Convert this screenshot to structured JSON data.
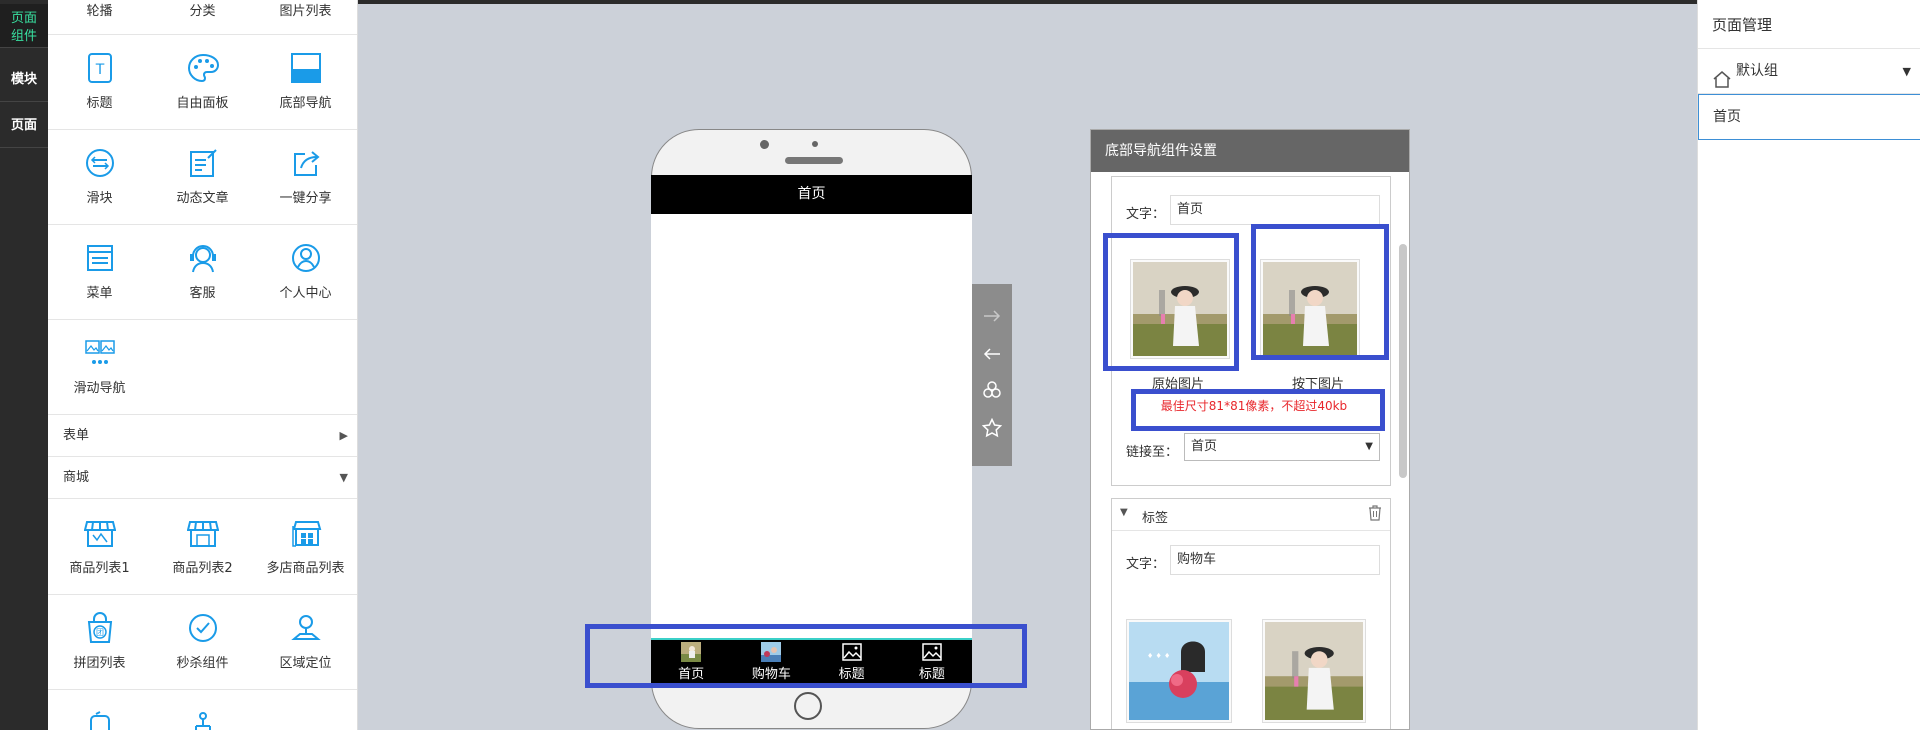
{
  "rail": {
    "items": [
      "页面组件",
      "模块",
      "页面"
    ]
  },
  "panel": {
    "top_row": [
      "轮播",
      "分类",
      "图片列表"
    ],
    "rows": [
      [
        {
          "label": "标题",
          "icon": "title-icon"
        },
        {
          "label": "自由面板",
          "icon": "palette-icon"
        },
        {
          "label": "底部导航",
          "icon": "bottom-nav-icon"
        }
      ],
      [
        {
          "label": "滑块",
          "icon": "slider-icon"
        },
        {
          "label": "动态文章",
          "icon": "article-icon"
        },
        {
          "label": "一键分享",
          "icon": "share-icon"
        }
      ],
      [
        {
          "label": "菜单",
          "icon": "menu-icon"
        },
        {
          "label": "客服",
          "icon": "customer-service-icon"
        },
        {
          "label": "个人中心",
          "icon": "user-center-icon"
        }
      ],
      [
        {
          "label": "滑动导航",
          "icon": "swipe-nav-icon"
        }
      ]
    ],
    "section_form": "表单",
    "section_form_arrow": "▶",
    "section_mall": "商城",
    "section_mall_arrow": "▼",
    "mall_rows": [
      [
        {
          "label": "商品列表1",
          "icon": "store-icon"
        },
        {
          "label": "商品列表2",
          "icon": "store-icon"
        },
        {
          "label": "多店商品列表",
          "icon": "multi-store-icon"
        }
      ],
      [
        {
          "label": "拼团列表",
          "icon": "group-buy-icon"
        },
        {
          "label": "秒杀组件",
          "icon": "flash-sale-icon"
        },
        {
          "label": "区域定位",
          "icon": "location-icon"
        }
      ]
    ]
  },
  "phone": {
    "header_title": "首页",
    "tabs": [
      "首页",
      "购物车",
      "标题",
      "标题"
    ]
  },
  "settings": {
    "title": "底部导航组件设置",
    "item1": {
      "text_label": "文字：",
      "text_value": "首页",
      "original_caption": "原始图片",
      "pressed_caption": "按下图片",
      "hint": "最佳尺寸81*81像素，不超过40kb",
      "link_label": "链接至：",
      "link_value": "首页",
      "link_arrow": "▼"
    },
    "item2": {
      "section_label": "标签",
      "collapse_arrow": "▼",
      "text_label": "文字：",
      "text_value": "购物车"
    }
  },
  "page_manager": {
    "title": "页面管理",
    "group": "默认组",
    "group_arrow": "▼",
    "page": "首页"
  },
  "colors": {
    "rail_bg": "#2b2b2b",
    "rail_active": "#38e0a0",
    "icon_blue": "#1a9be8",
    "highlight": "#3a4fce",
    "hint_red": "#e8272c",
    "tab_border": "#3bd0c8"
  }
}
